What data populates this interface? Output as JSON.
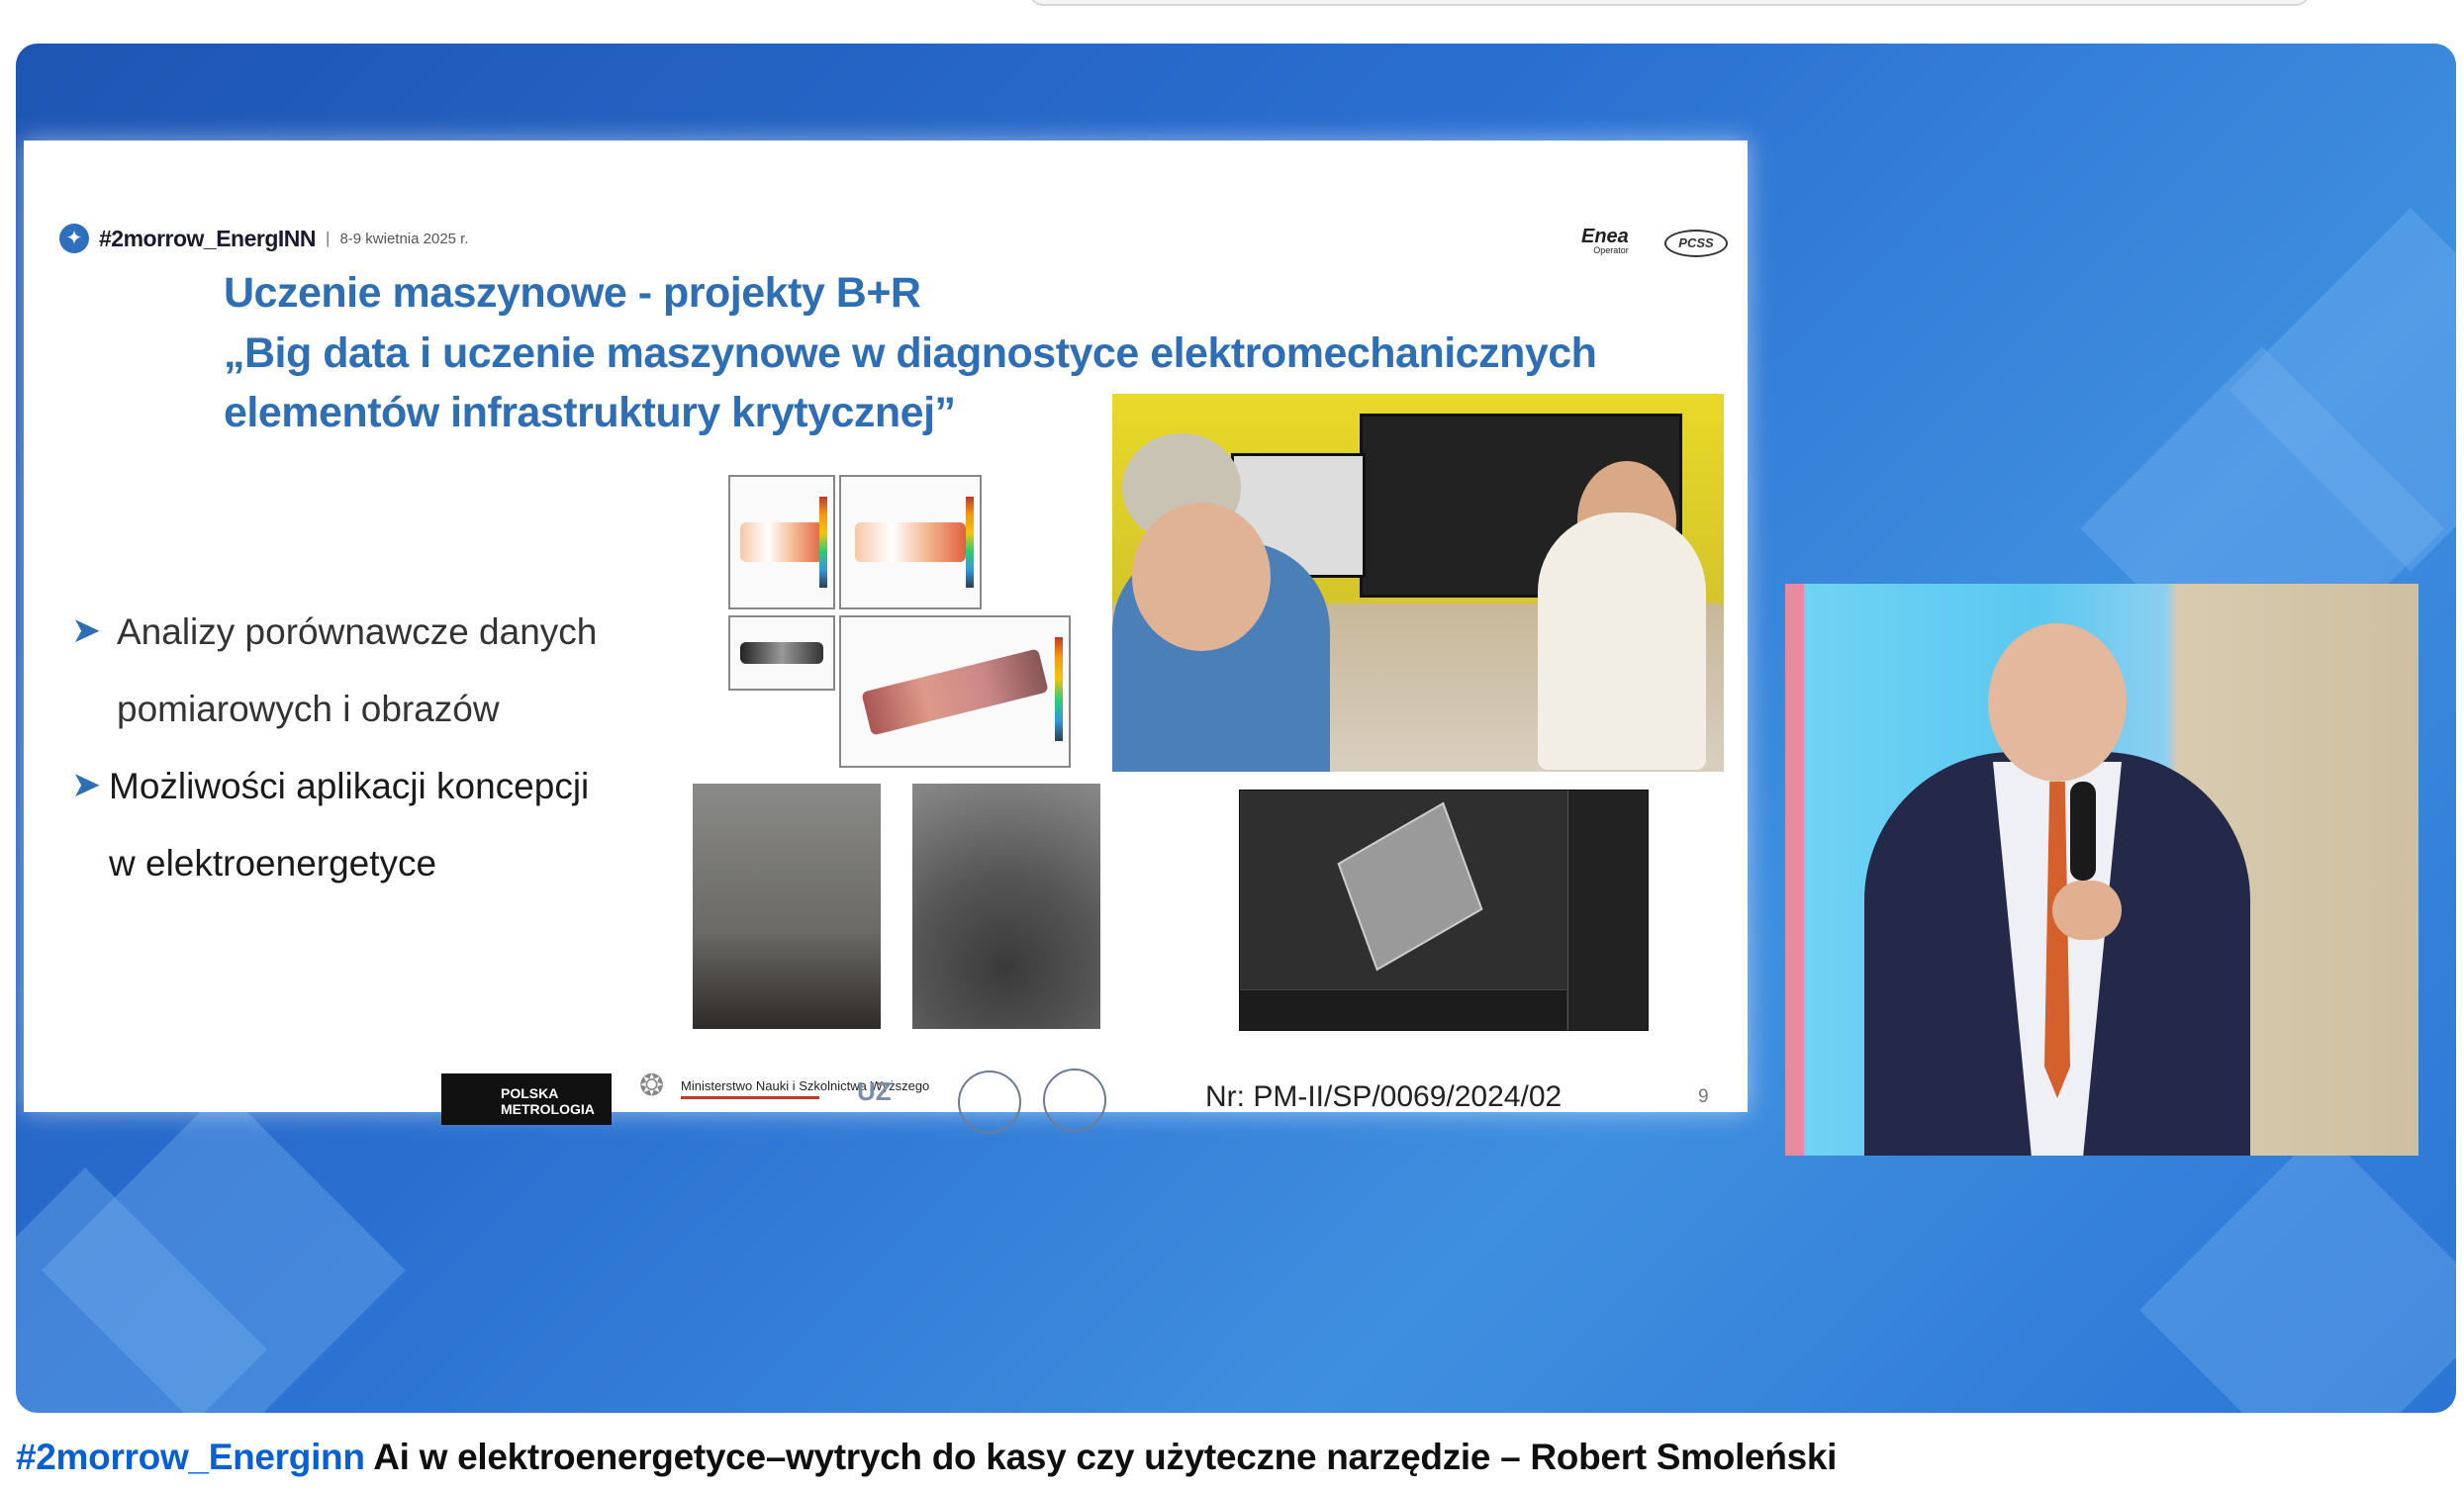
{
  "video": {
    "slide": {
      "event_name": "#2morrow_EnergINN",
      "event_separator": "|",
      "event_date": "8-9 kwietnia 2025 r.",
      "partner_enea": "Enea",
      "partner_enea_sub": "Operator",
      "partner_pcss": "PCSS",
      "title_line1": "Uczenie maszynowe - projekty B+R",
      "title_line2": "„Big data i uczenie maszynowe w diagnostyce elektromechanicznych",
      "title_line3": "elementów infrastruktury krytycznej”",
      "bullets": [
        {
          "line1": "Analizy porównawcze danych",
          "line2": "pomiarowych i obrazów"
        },
        {
          "line1": "Możliwości aplikacji koncepcji",
          "line2": "w elektroenergetyce"
        }
      ],
      "logo_pm": "POLSKA METROLOGIA",
      "logo_ministry": "Ministerstwo Nauki i Szkolnictwa Wyższego",
      "logo_uz": "UZ",
      "project_number": "Nr: PM-II/SP/0069/2024/02",
      "page_number": "9"
    }
  },
  "caption": {
    "hashtag": "#2morrow_Energinn",
    "title": " Ai w elektroenergetyce–wytrych do kasy czy użyteczne narzędzie – Robert Smoleński"
  }
}
